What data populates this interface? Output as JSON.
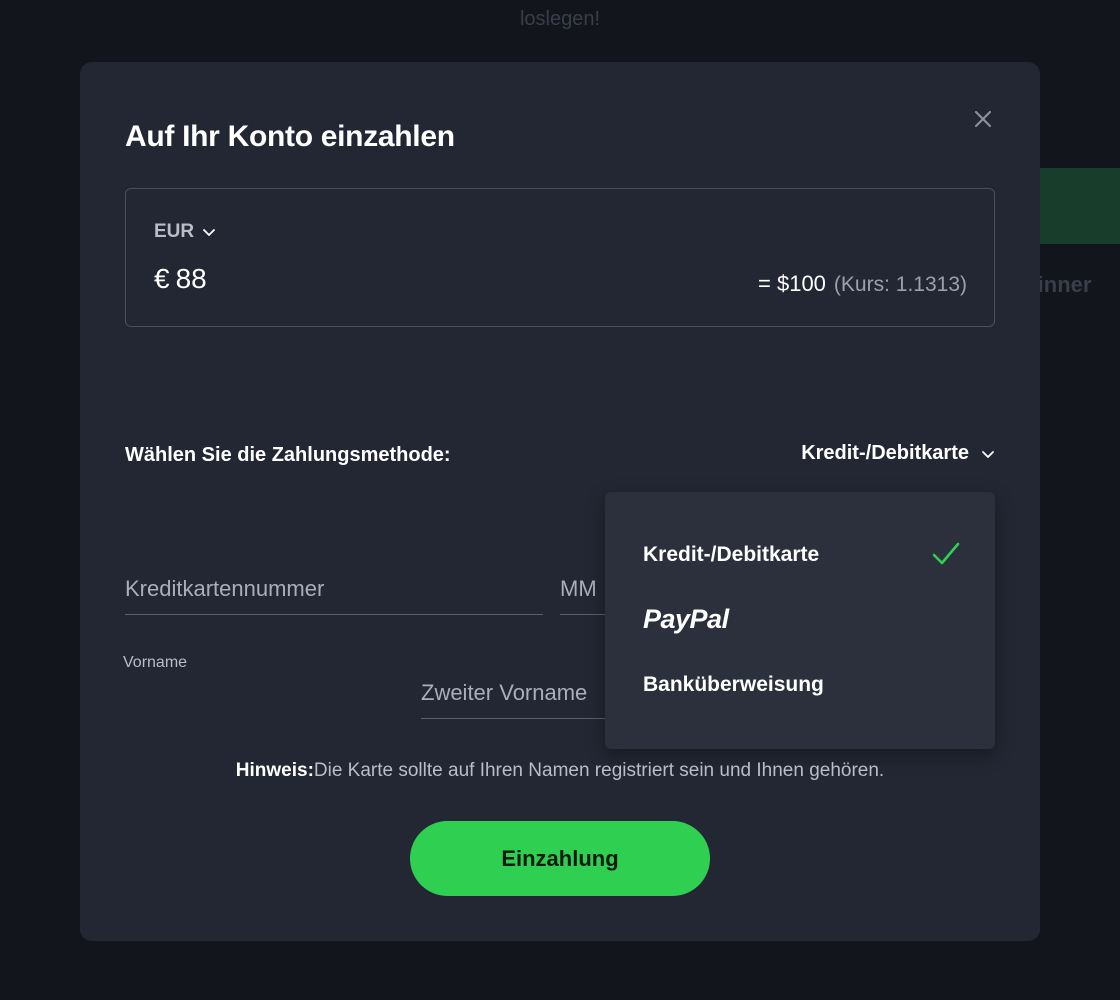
{
  "background": {
    "top_text": "loslegen!",
    "right_text": "eginner"
  },
  "modal": {
    "title": "Auf Ihr Konto einzahlen",
    "close_icon": "close-icon",
    "amount": {
      "currency": "EUR",
      "currency_icon": "chevron-down-icon",
      "symbol": "€",
      "value": "88",
      "converted": "= $100",
      "rate": "(Kurs: 1.1313)"
    },
    "payment": {
      "label": "Wählen Sie die Zahlungsmethode:",
      "selected": "Kredit-/Debitkarte",
      "options": [
        {
          "label": "Kredit-/Debitkarte",
          "selected": true
        },
        {
          "label": "PayPal",
          "selected": false
        },
        {
          "label": "Banküberweisung",
          "selected": false
        }
      ]
    },
    "form": {
      "card_number_placeholder": "Kreditkartennummer",
      "month_placeholder": "MM",
      "first_name_label": "Vorname",
      "middle_name_placeholder": "Zweiter Vorname"
    },
    "notice": {
      "strong": "Hinweis:",
      "text": "Die Karte sollte auf Ihren Namen registriert sein und Ihnen gehören."
    },
    "submit_label": "Einzahlung"
  },
  "colors": {
    "accent_green": "#2fcf52",
    "modal_bg": "#232733",
    "dropdown_bg": "#2b303c",
    "page_bg": "#13151d"
  }
}
